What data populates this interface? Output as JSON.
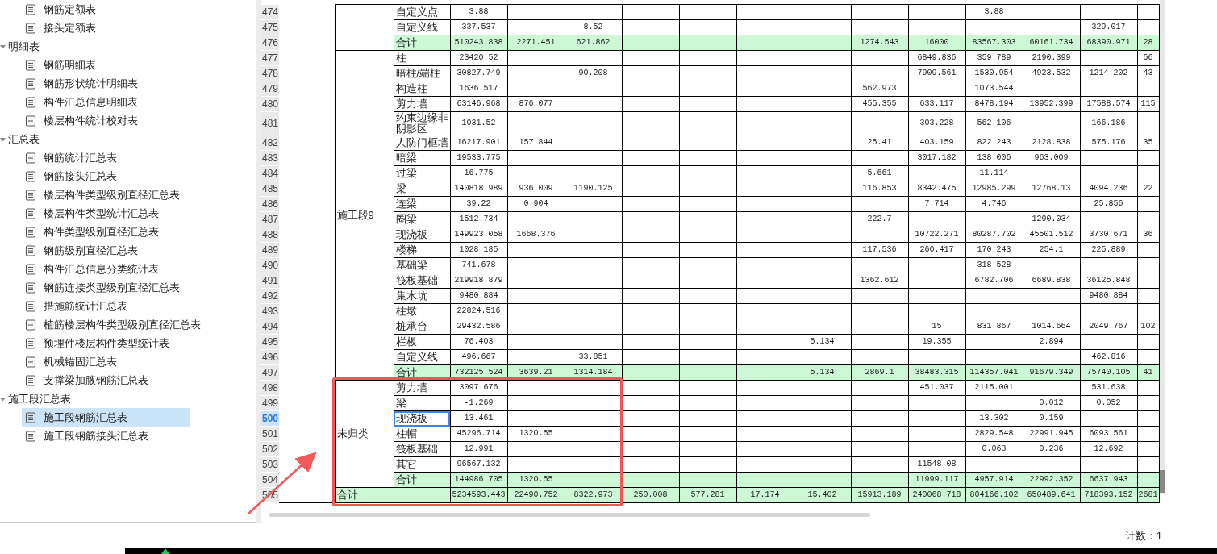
{
  "sidebar": {
    "items": [
      {
        "kind": "report",
        "label": "钢筋定额表",
        "selected": false
      },
      {
        "kind": "report",
        "label": "接头定额表",
        "selected": false
      },
      {
        "kind": "group",
        "label": "明细表",
        "expanded": true,
        "children": [
          {
            "kind": "report",
            "label": "钢筋明细表",
            "selected": false
          },
          {
            "kind": "report",
            "label": "钢筋形状统计明细表",
            "selected": false
          },
          {
            "kind": "report",
            "label": "构件汇总信息明细表",
            "selected": false
          },
          {
            "kind": "report",
            "label": "楼层构件统计校对表",
            "selected": false
          }
        ]
      },
      {
        "kind": "group",
        "label": "汇总表",
        "expanded": true,
        "children": [
          {
            "kind": "report",
            "label": "钢筋统计汇总表",
            "selected": false
          },
          {
            "kind": "report",
            "label": "钢筋接头汇总表",
            "selected": false
          },
          {
            "kind": "report",
            "label": "楼层构件类型级别直径汇总表",
            "selected": false
          },
          {
            "kind": "report",
            "label": "楼层构件类型统计汇总表",
            "selected": false
          },
          {
            "kind": "report",
            "label": "构件类型级别直径汇总表",
            "selected": false
          },
          {
            "kind": "report",
            "label": "钢筋级别直径汇总表",
            "selected": false
          },
          {
            "kind": "report",
            "label": "构件汇总信息分类统计表",
            "selected": false
          },
          {
            "kind": "report",
            "label": "钢筋连接类型级别直径汇总表",
            "selected": false
          },
          {
            "kind": "report",
            "label": "措施筋统计汇总表",
            "selected": false
          },
          {
            "kind": "report",
            "label": "植筋楼层构件类型级别直径汇总表",
            "selected": false
          },
          {
            "kind": "report",
            "label": "预埋件楼层构件类型统计表",
            "selected": false
          },
          {
            "kind": "report",
            "label": "机械锚固汇总表",
            "selected": false
          },
          {
            "kind": "report",
            "label": "支撑梁加腋钢筋汇总表",
            "selected": false
          }
        ]
      },
      {
        "kind": "group",
        "label": "施工段汇总表",
        "expanded": true,
        "children": [
          {
            "kind": "report",
            "label": "施工段钢筋汇总表",
            "selected": true
          },
          {
            "kind": "report",
            "label": "施工段钢筋接头汇总表",
            "selected": false
          }
        ]
      }
    ]
  },
  "sheet": {
    "groups": [
      {
        "rows": [
          {
            "row_number": "474",
            "name": "自定义点",
            "kind": "item",
            "selected": false,
            "cells": {
              "column_1": "3.88",
              "column_10": "3.88"
            }
          },
          {
            "row_number": "475",
            "name": "自定义线",
            "kind": "item",
            "selected": false,
            "cells": {
              "column_1": "337.537",
              "column_3": "8.52",
              "column_12": "329.017"
            }
          },
          {
            "row_number": "476",
            "name": "合计",
            "kind": "subtotal",
            "selected": false,
            "cells": {
              "column_1": "510243.838",
              "column_2": "2271.451",
              "column_3": "621.862",
              "column_8": "1274.543",
              "column_9": "16000",
              "column_10": "83567.303",
              "column_11": "60161.734",
              "column_12": "68390.971",
              "column_13": "28"
            }
          }
        ]
      },
      {
        "label": "施工段9",
        "rows": [
          {
            "row_number": "477",
            "name": "柱",
            "kind": "item",
            "selected": false,
            "cells": {
              "column_1": "23420.52",
              "column_9": "6849.836",
              "column_10": "359.789",
              "column_11": "2190.399",
              "column_13": "56"
            }
          },
          {
            "row_number": "478",
            "name": "暗柱/端柱",
            "kind": "item",
            "selected": false,
            "cells": {
              "column_1": "30827.749",
              "column_3": "90.208",
              "column_9": "7909.561",
              "column_10": "1530.954",
              "column_11": "4923.532",
              "column_12": "1214.202",
              "column_13": "43"
            }
          },
          {
            "row_number": "479",
            "name": "构造柱",
            "kind": "item",
            "selected": false,
            "cells": {
              "column_1": "1636.517",
              "column_8": "562.973",
              "column_10": "1073.544"
            }
          },
          {
            "row_number": "480",
            "name": "剪力墙",
            "kind": "item",
            "selected": false,
            "cells": {
              "column_1": "63146.968",
              "column_2": "876.077",
              "column_8": "455.355",
              "column_9": "633.117",
              "column_10": "8478.194",
              "column_11": "13952.399",
              "column_12": "17588.574",
              "column_13": "115"
            }
          },
          {
            "row_number": "481",
            "name": "约束边缘非阴影区",
            "kind": "item",
            "selected": false,
            "cells": {
              "column_1": "1031.52",
              "column_9": "303.228",
              "column_10": "562.106",
              "column_12": "166.186"
            }
          },
          {
            "row_number": "482",
            "name": "人防门框墙",
            "kind": "item",
            "selected": false,
            "cells": {
              "column_1": "16217.901",
              "column_2": "157.844",
              "column_8": "25.41",
              "column_9": "403.159",
              "column_10": "822.243",
              "column_11": "2128.838",
              "column_12": "575.176",
              "column_13": "35"
            }
          },
          {
            "row_number": "483",
            "name": "暗梁",
            "kind": "item",
            "selected": false,
            "cells": {
              "column_1": "19533.775",
              "column_9": "3017.182",
              "column_10": "138.006",
              "column_11": "963.009"
            }
          },
          {
            "row_number": "484",
            "name": "过梁",
            "kind": "item",
            "selected": false,
            "cells": {
              "column_1": "16.775",
              "column_8": "5.661",
              "column_10": "11.114"
            }
          },
          {
            "row_number": "485",
            "name": "梁",
            "kind": "item",
            "selected": false,
            "cells": {
              "column_1": "140818.989",
              "column_2": "936.009",
              "column_3": "1190.125",
              "column_8": "116.853",
              "column_9": "8342.475",
              "column_10": "12985.299",
              "column_11": "12768.13",
              "column_12": "4094.236",
              "column_13": "22"
            }
          },
          {
            "row_number": "486",
            "name": "连梁",
            "kind": "item",
            "selected": false,
            "cells": {
              "column_1": "39.22",
              "column_2": "0.904",
              "column_9": "7.714",
              "column_10": "4.746",
              "column_12": "25.856"
            }
          },
          {
            "row_number": "487",
            "name": "圈梁",
            "kind": "item",
            "selected": false,
            "cells": {
              "column_1": "1512.734",
              "column_8": "222.7",
              "column_11": "1290.034"
            }
          },
          {
            "row_number": "488",
            "name": "现浇板",
            "kind": "item",
            "selected": false,
            "cells": {
              "column_1": "149923.058",
              "column_2": "1668.376",
              "column_9": "10722.271",
              "column_10": "80287.702",
              "column_11": "45501.512",
              "column_12": "3730.671",
              "column_13": "36"
            }
          },
          {
            "row_number": "489",
            "name": "楼梯",
            "kind": "item",
            "selected": false,
            "cells": {
              "column_1": "1028.185",
              "column_8": "117.536",
              "column_9": "260.417",
              "column_10": "170.243",
              "column_11": "254.1",
              "column_12": "225.889"
            }
          },
          {
            "row_number": "490",
            "name": "基础梁",
            "kind": "item",
            "selected": false,
            "cells": {
              "column_1": "741.678",
              "column_10": "318.528"
            }
          },
          {
            "row_number": "491",
            "name": "筏板基础",
            "kind": "item",
            "selected": false,
            "cells": {
              "column_1": "219918.879",
              "column_8": "1362.612",
              "column_10": "6782.706",
              "column_11": "6689.838",
              "column_12": "36125.848"
            }
          },
          {
            "row_number": "492",
            "name": "集水坑",
            "kind": "item",
            "selected": false,
            "cells": {
              "column_1": "9480.884",
              "column_12": "9480.884"
            }
          },
          {
            "row_number": "493",
            "name": "柱墩",
            "kind": "item",
            "selected": false,
            "cells": {
              "column_1": "22824.516"
            }
          },
          {
            "row_number": "494",
            "name": "桩承台",
            "kind": "item",
            "selected": false,
            "cells": {
              "column_1": "29432.586",
              "column_9": "15",
              "column_10": "831.867",
              "column_11": "1014.664",
              "column_12": "2049.767",
              "column_13": "102"
            }
          },
          {
            "row_number": "495",
            "name": "栏板",
            "kind": "item",
            "selected": false,
            "cells": {
              "column_1": "76.403",
              "column_7": "5.134",
              "column_9": "19.355",
              "column_11": "2.894"
            }
          },
          {
            "row_number": "496",
            "name": "自定义线",
            "kind": "item",
            "selected": false,
            "cells": {
              "column_1": "496.667",
              "column_3": "33.851",
              "column_12": "462.816"
            }
          },
          {
            "row_number": "497",
            "name": "合计",
            "kind": "subtotal",
            "selected": false,
            "cells": {
              "column_1": "732125.524",
              "column_2": "3639.21",
              "column_3": "1314.184",
              "column_7": "5.134",
              "column_8": "2869.1",
              "column_9": "38483.315",
              "column_10": "114357.041",
              "column_11": "91679.349",
              "column_12": "75740.105",
              "column_13": "41"
            }
          }
        ]
      },
      {
        "label": "未归类",
        "rows": [
          {
            "row_number": "498",
            "name": "剪力墙",
            "kind": "item",
            "selected": false,
            "cells": {
              "column_1": "3097.676",
              "column_9": "451.037",
              "column_10": "2115.001",
              "column_12": "531.638"
            }
          },
          {
            "row_number": "499",
            "name": "梁",
            "kind": "item",
            "selected": false,
            "cells": {
              "column_1": "-1.269",
              "column_11": "0.012",
              "column_12": "0.052"
            }
          },
          {
            "row_number": "500",
            "name": "现浇板",
            "kind": "item",
            "selected": true,
            "cells": {
              "column_1": "13.461",
              "column_10": "13.302",
              "column_11": "0.159"
            }
          },
          {
            "row_number": "501",
            "name": "柱帽",
            "kind": "item",
            "selected": false,
            "cells": {
              "column_1": "45296.714",
              "column_2": "1320.55",
              "column_10": "2829.548",
              "column_11": "22991.945",
              "column_12": "6093.561"
            }
          },
          {
            "row_number": "502",
            "name": "筏板基础",
            "kind": "item",
            "selected": false,
            "cells": {
              "column_1": "12.991",
              "column_10": "0.063",
              "column_11": "0.236",
              "column_12": "12.692"
            }
          },
          {
            "row_number": "503",
            "name": "其它",
            "kind": "item",
            "selected": false,
            "cells": {
              "column_1": "96567.132",
              "column_9": "11548.08"
            }
          },
          {
            "row_number": "504",
            "name": "合计",
            "kind": "subtotal",
            "selected": false,
            "cells": {
              "column_1": "144986.705",
              "column_2": "1320.55",
              "column_9": "11999.117",
              "column_10": "4957.914",
              "column_11": "22992.352",
              "column_12": "6637.943"
            }
          }
        ]
      }
    ],
    "grand_total": {
      "row_number": "505",
      "label": "合计",
      "selected": false,
      "cells": {
        "column_1": "5234593.443",
        "column_2": "22490.752",
        "column_3": "8322.973",
        "column_4": "250.008",
        "column_5": "577.281",
        "column_6": "17.174",
        "column_7": "15.402",
        "column_8": "15913.189",
        "column_9": "240068.718",
        "column_10": "804166.102",
        "column_11": "650489.641",
        "column_12": "718393.152",
        "column_13": "2681"
      }
    }
  },
  "status_bar": {
    "count": "计数：1"
  }
}
